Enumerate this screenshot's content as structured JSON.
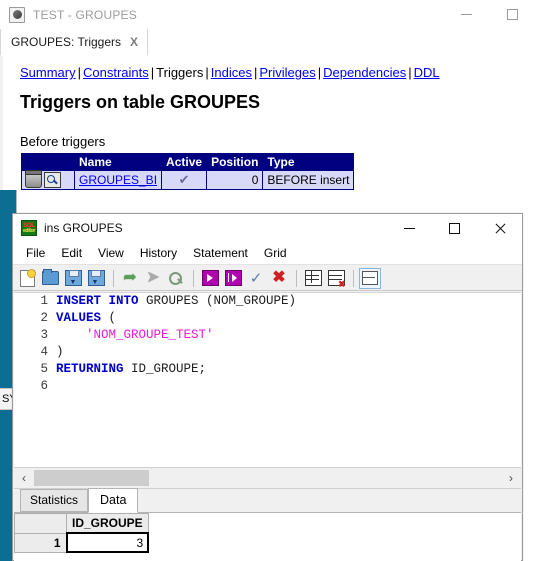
{
  "outer_window": {
    "title": "TEST - GROUPES",
    "icon": "app-icon",
    "buttons": [
      {
        "name": "minimize",
        "glyph": "minimize-icon"
      },
      {
        "name": "maximize",
        "glyph": "maximize-icon"
      }
    ]
  },
  "document_tab": {
    "label": "GROUPES: Triggers",
    "close_label": "X"
  },
  "report": {
    "nav_links": [
      {
        "label": "Summary",
        "is_link": true
      },
      {
        "label": "Constraints",
        "is_link": true
      },
      {
        "label": "Triggers",
        "is_link": false
      },
      {
        "label": "Indices",
        "is_link": true
      },
      {
        "label": "Privileges",
        "is_link": true
      },
      {
        "label": "Dependencies",
        "is_link": true
      },
      {
        "label": "DDL",
        "is_link": true
      }
    ],
    "separator": "|",
    "heading": "Triggers on table GROUPES",
    "section_heading": "Before triggers",
    "triggers_table": {
      "headers": [
        "",
        "Name",
        "Active",
        "Position",
        "Type"
      ],
      "rows": [
        {
          "delete_icon": "trash-icon",
          "inspect_icon": "magnifier-icon",
          "name": "GROUPES_BI",
          "active": "✔",
          "position": "0",
          "type": "BEFORE insert"
        }
      ]
    }
  },
  "background_window": {
    "tab_label": "SY"
  },
  "sql_window": {
    "title": "ins GROUPES",
    "icon_line1": "SQL",
    "icon_line2": "editor",
    "buttons": [
      {
        "name": "minimize",
        "glyph": "minimize-icon"
      },
      {
        "name": "maximize",
        "glyph": "maximize-icon"
      },
      {
        "name": "close",
        "glyph": "close-icon"
      }
    ],
    "menu": [
      "File",
      "Edit",
      "View",
      "History",
      "Statement",
      "Grid"
    ],
    "toolbar": [
      {
        "name": "new-script-button",
        "icon": "new-document-icon"
      },
      {
        "name": "open-script-button",
        "icon": "open-folder-icon"
      },
      {
        "name": "save-script-button",
        "icon": "save-disk-icon"
      },
      {
        "name": "save-as-button",
        "icon": "save-as-disk-icon"
      },
      {
        "name": "separator-1",
        "icon": "separator"
      },
      {
        "name": "history-back-button",
        "icon": "arrow-left-icon"
      },
      {
        "name": "history-forward-button",
        "icon": "arrow-right-icon"
      },
      {
        "name": "history-search-button",
        "icon": "magnifier-arrow-icon"
      },
      {
        "name": "separator-2",
        "icon": "separator"
      },
      {
        "name": "execute-button",
        "icon": "play-icon"
      },
      {
        "name": "execute-step-button",
        "icon": "play-step-icon"
      },
      {
        "name": "commit-button",
        "icon": "checkmark-icon"
      },
      {
        "name": "rollback-button",
        "icon": "red-cross-icon"
      },
      {
        "name": "separator-3",
        "icon": "separator"
      },
      {
        "name": "grid-insert-button",
        "icon": "grid-plus-icon"
      },
      {
        "name": "grid-delete-button",
        "icon": "grid-delete-icon"
      },
      {
        "name": "separator-4",
        "icon": "separator"
      },
      {
        "name": "toggle-split-button",
        "icon": "split-pane-icon"
      }
    ],
    "editor_lines": [
      {
        "num": "1",
        "tokens": [
          {
            "t": "INSERT INTO",
            "c": "kw"
          },
          {
            "t": " GROUPES (NOM_GROUPE)",
            "c": "plain"
          }
        ]
      },
      {
        "num": "2",
        "tokens": [
          {
            "t": "VALUES",
            "c": "kw"
          },
          {
            "t": " (",
            "c": "plain"
          }
        ]
      },
      {
        "num": "3",
        "tokens": [
          {
            "t": "    'NOM_GROUPE_TEST'",
            "c": "str"
          }
        ]
      },
      {
        "num": "4",
        "tokens": [
          {
            "t": ")",
            "c": "plain"
          }
        ]
      },
      {
        "num": "5",
        "tokens": [
          {
            "t": "RETURNING",
            "c": "kw"
          },
          {
            "t": " ID_GROUPE;",
            "c": "plain"
          }
        ]
      },
      {
        "num": "6",
        "tokens": [
          {
            "t": "",
            "c": "plain"
          }
        ]
      }
    ],
    "hscroll": {
      "left_arrow": "‹",
      "right_arrow": "›"
    },
    "result_tabs": [
      {
        "label": "Statistics",
        "active": false
      },
      {
        "label": "Data",
        "active": true
      }
    ],
    "data_grid": {
      "row_header": "",
      "columns": [
        "ID_GROUPE"
      ],
      "rows": [
        {
          "num": "1",
          "values": [
            "3"
          ]
        }
      ]
    }
  },
  "colors": {
    "table_header_bg": "#000080",
    "table_row_bg": "#d8d8f8",
    "link": "#0000ee",
    "keyword": "#0000c8",
    "string": "#ee1ad2",
    "bg_window_strip": "#0c6e93",
    "sql_icon_bg": "#147814"
  }
}
